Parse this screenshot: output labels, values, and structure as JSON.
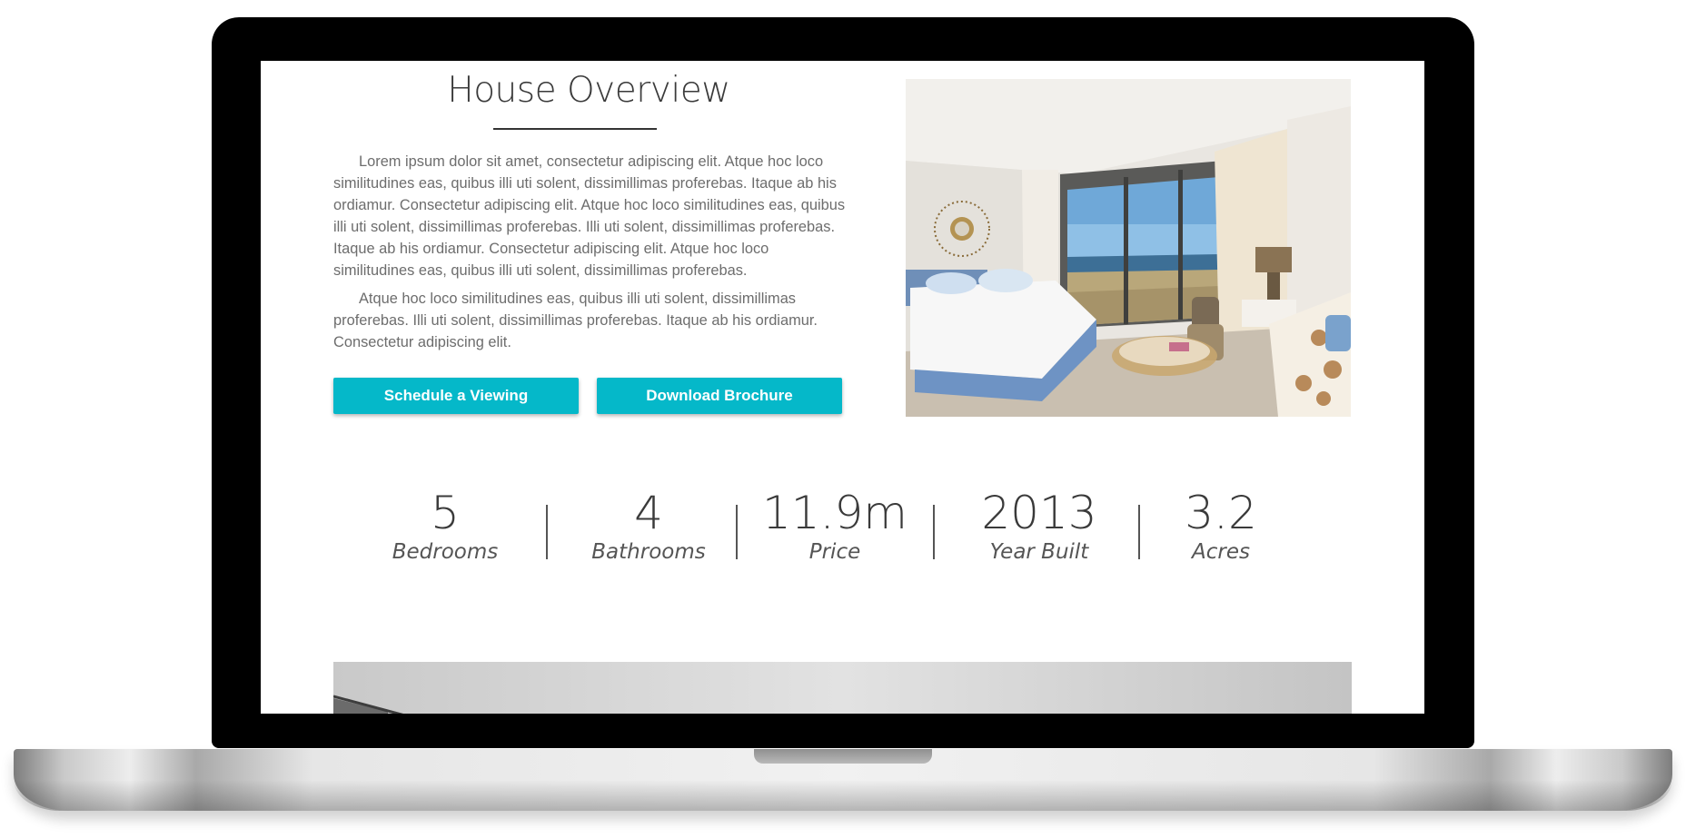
{
  "overview": {
    "title": "House Overview",
    "paragraphs": [
      "Lorem ipsum dolor sit amet, consectetur adipiscing elit. Atque hoc loco similitudines eas, quibus illi uti solent, dissimillimas proferebas. Itaque ab his ordiamur. Consectetur adipiscing elit. Atque hoc loco similitudines eas, quibus illi uti solent, dissimillimas proferebas. Illi uti solent, dissimillimas proferebas. Itaque ab his ordiamur. Consectetur adipiscing elit. Atque hoc loco similitudines eas, quibus illi uti solent, dissimillimas proferebas.",
      "Atque hoc loco similitudines eas, quibus illi uti solent, dissimillimas proferebas. Illi uti solent, dissimillimas proferebas. Itaque ab his ordiamur. Consectetur adipiscing elit."
    ],
    "buttons": {
      "schedule": "Schedule a Viewing",
      "brochure": "Download Brochure"
    }
  },
  "stats": [
    {
      "value": "5",
      "label": "Bedrooms"
    },
    {
      "value": "4",
      "label": "Bathrooms"
    },
    {
      "value": "11.9m",
      "label": "Price"
    },
    {
      "value": "2013",
      "label": "Year Built"
    },
    {
      "value": "3.2",
      "label": "Acres"
    }
  ],
  "colors": {
    "accent": "#05b8c9",
    "text": "#3a3a3a",
    "bezel": "#000000"
  }
}
